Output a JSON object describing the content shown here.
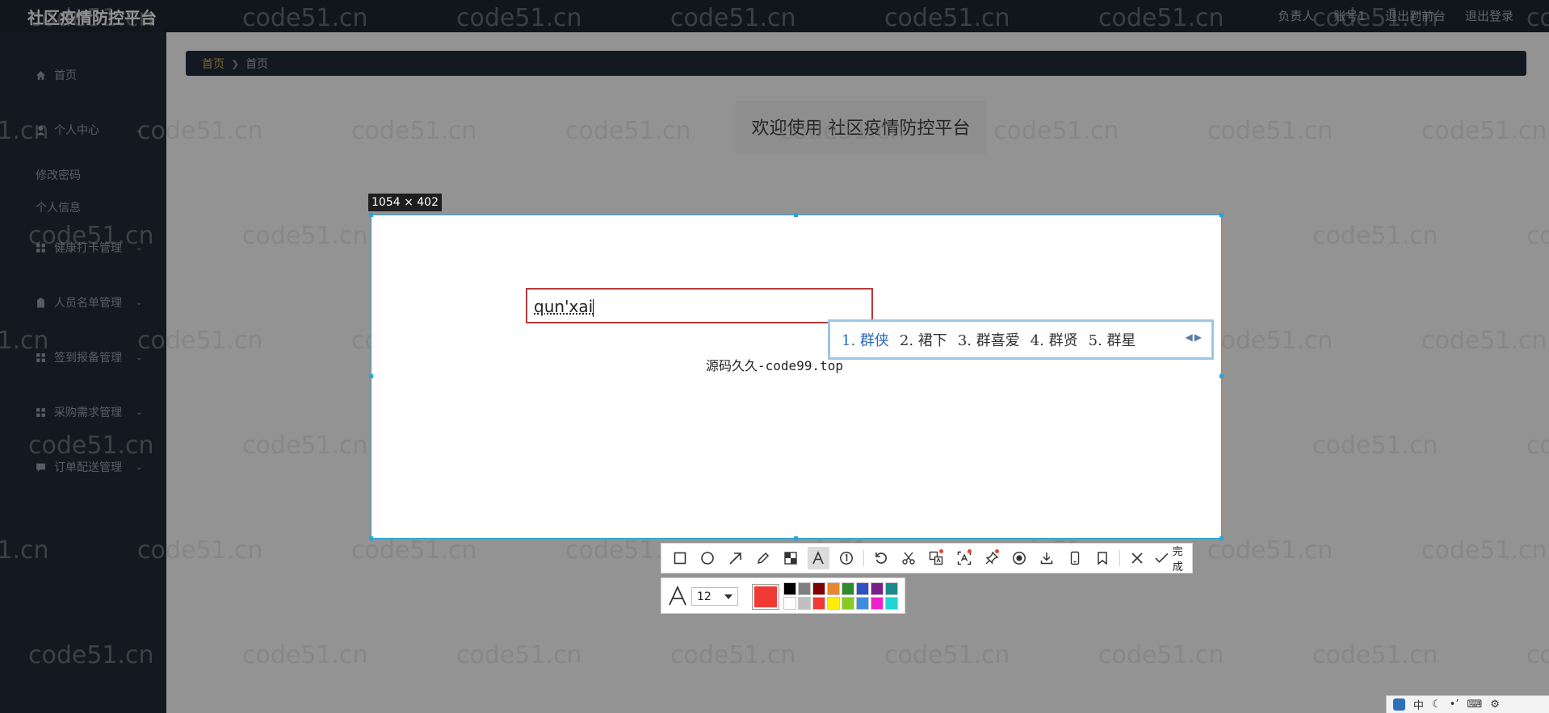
{
  "header": {
    "brand": "社区疫情防控平台",
    "links": [
      "负责人",
      "账号1",
      "退出到前台",
      "退出登录"
    ]
  },
  "sidebar": {
    "items": [
      {
        "label": "首页",
        "icon": "home-icon",
        "has_children": false
      },
      {
        "label": "个人中心",
        "icon": "user-icon",
        "has_children": true
      },
      {
        "label": "健康打卡管理",
        "icon": "grid-icon",
        "has_children": true
      },
      {
        "label": "人员名单管理",
        "icon": "clipboard-icon",
        "has_children": true
      },
      {
        "label": "签到报备管理",
        "icon": "grid-icon",
        "has_children": true
      },
      {
        "label": "采购需求管理",
        "icon": "grid-icon",
        "has_children": true
      },
      {
        "label": "订单配送管理",
        "icon": "chat-icon",
        "has_children": true
      }
    ],
    "subitems": [
      "修改密码",
      "个人信息"
    ]
  },
  "breadcrumb": {
    "home": "首页",
    "current": "首页"
  },
  "welcome": "欢迎使用 社区疫情防控平台",
  "watermark": "code51.cn",
  "capture": {
    "size_label": "1054 × 402",
    "text_input_value": "qun'xai",
    "caption": "源码久久-code99.top",
    "selection_border_color": "#20a6e0"
  },
  "ime": {
    "candidates": [
      "1. 群侠",
      "2. 裙下",
      "3. 群喜爱",
      "4. 群贤",
      "5. 群星"
    ]
  },
  "toolbar": {
    "tools": [
      {
        "name": "rectangle-tool",
        "icon": "square-icon",
        "active": false,
        "badge": false
      },
      {
        "name": "ellipse-tool",
        "icon": "circle-icon",
        "active": false,
        "badge": false
      },
      {
        "name": "arrow-tool",
        "icon": "arrow-icon",
        "active": false,
        "badge": false
      },
      {
        "name": "pencil-tool",
        "icon": "pencil-icon",
        "active": false,
        "badge": false
      },
      {
        "name": "mosaic-tool",
        "icon": "mosaic-icon",
        "active": false,
        "badge": false
      },
      {
        "name": "text-tool",
        "icon": "text-icon",
        "active": true,
        "badge": false
      },
      {
        "name": "number-tool",
        "icon": "number-icon",
        "active": false,
        "badge": false
      },
      {
        "name": "undo-tool",
        "icon": "undo-icon",
        "active": false,
        "badge": false
      },
      {
        "name": "cut-tool",
        "icon": "scissors-icon",
        "active": false,
        "badge": false
      },
      {
        "name": "translate-tool",
        "icon": "translate-icon",
        "active": false,
        "badge": true
      },
      {
        "name": "ocr-tool",
        "icon": "ocr-icon",
        "active": false,
        "badge": true
      },
      {
        "name": "pin-tool",
        "icon": "pin-icon",
        "active": false,
        "badge": true
      },
      {
        "name": "record-tool",
        "icon": "record-icon",
        "active": false,
        "badge": false
      },
      {
        "name": "download-tool",
        "icon": "download-icon",
        "active": false,
        "badge": false
      },
      {
        "name": "phone-tool",
        "icon": "phone-icon",
        "active": false,
        "badge": false
      },
      {
        "name": "bookmark-tool",
        "icon": "bookmark-icon",
        "active": false,
        "badge": false
      }
    ],
    "done_label": "完成"
  },
  "props": {
    "font_size": "12",
    "current_color": "#f03a35",
    "palette": [
      "#000000",
      "#808080",
      "#800000",
      "#e8872f",
      "#2e8b2e",
      "#3050c8",
      "#7a1f8a",
      "#1a8a8a",
      "#ffffff",
      "#c0c0c0",
      "#f03a35",
      "#ffee00",
      "#88cc22",
      "#3c8ce0",
      "#ee22cc",
      "#22d4d4"
    ]
  },
  "tray": {
    "ime_label": "中"
  }
}
